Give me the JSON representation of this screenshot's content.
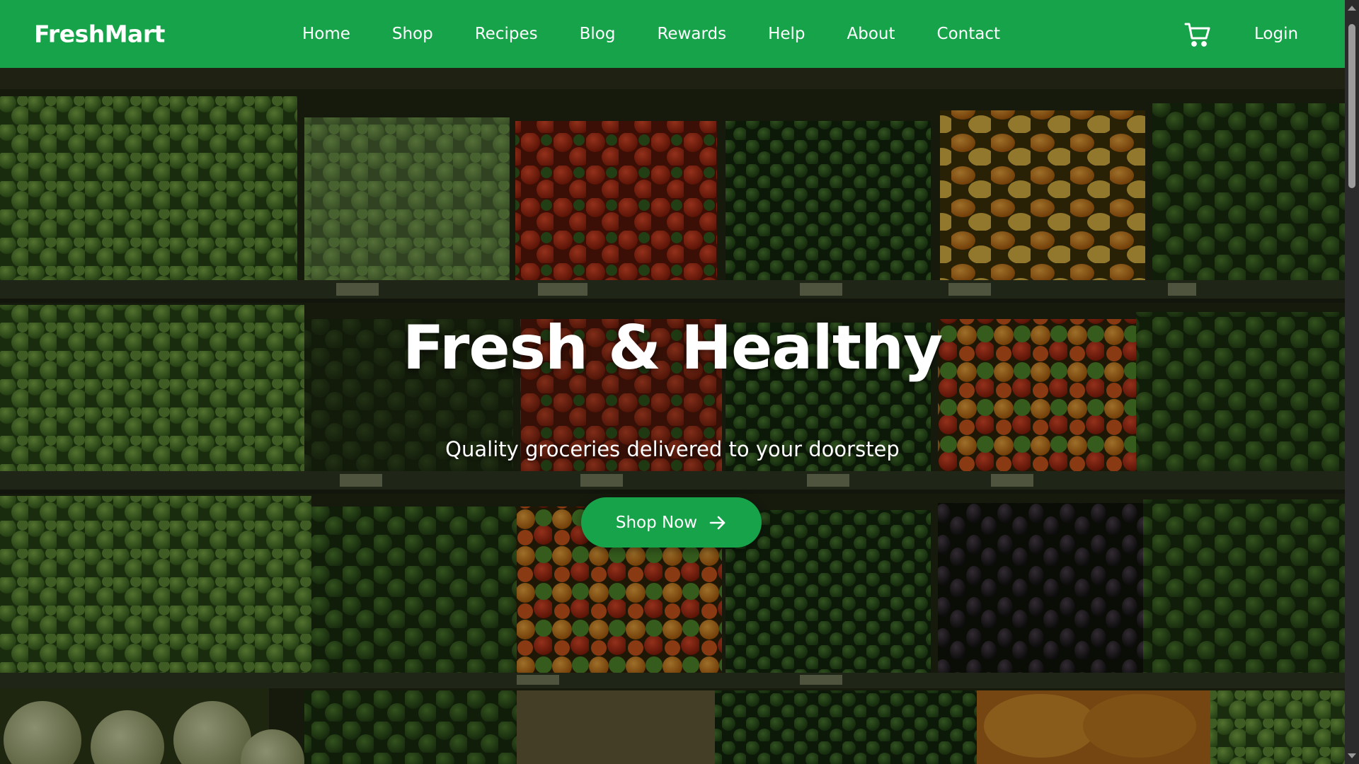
{
  "header": {
    "brand": "FreshMart",
    "nav": [
      {
        "label": "Home"
      },
      {
        "label": "Shop"
      },
      {
        "label": "Recipes"
      },
      {
        "label": "Blog"
      },
      {
        "label": "Rewards"
      },
      {
        "label": "Help"
      },
      {
        "label": "About"
      },
      {
        "label": "Contact"
      }
    ],
    "cart_icon": "shopping-cart-icon",
    "login_label": "Login"
  },
  "hero": {
    "title": "Fresh & Healthy",
    "subtitle": "Quality groceries delivered to your doorstep",
    "cta_label": "Shop Now",
    "cta_icon": "arrow-right-icon",
    "background": "grocery produce shelves photo"
  },
  "colors": {
    "brand_green": "#16a34a",
    "text_white": "#ffffff"
  }
}
